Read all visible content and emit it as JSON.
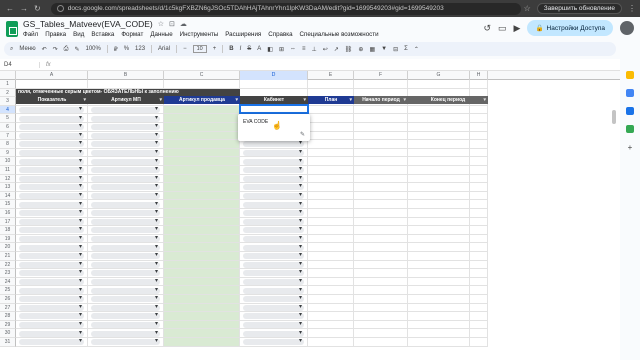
{
  "browser": {
    "url": "docs.google.com/spreadsheets/d/1c5kgFXBZN6gJSOc5TDAhHAjTAhnrYhn1lpKW3DaAM/edit?gid=1699549203#gid=1699549203",
    "update_button": "Завершить обновление"
  },
  "doc": {
    "title": "GS_Tables_Matveev(EVA_CODE)",
    "menu": [
      "Файл",
      "Правка",
      "Вид",
      "Вставка",
      "Формат",
      "Данные",
      "Инструменты",
      "Расширения",
      "Справка",
      "Специальные возможности"
    ],
    "access_button": "Настройки Доступа"
  },
  "toolbar": {
    "menu_label": "Меню",
    "zoom": "100%",
    "font": "Arial",
    "font_size": "10",
    "number_format": "123"
  },
  "formula": {
    "cell_ref": "D4",
    "fx": "fx"
  },
  "columns": [
    "A",
    "B",
    "C",
    "D",
    "E",
    "F",
    "G",
    "H"
  ],
  "rows": [
    "1",
    "2",
    "3",
    "4",
    "5",
    "6",
    "7",
    "8",
    "9",
    "10",
    "11",
    "12",
    "13",
    "14",
    "15",
    "16",
    "17",
    "18",
    "19",
    "20",
    "21",
    "22",
    "23",
    "24",
    "25",
    "26",
    "27",
    "28",
    "29",
    "30",
    "31"
  ],
  "sheet": {
    "banner": "поля, отмеченные серым цветом- ОБЯЗАТЕЛЬНЫ к заполнению",
    "headers": [
      "Показатель",
      "Артикул МП",
      "Артикул продавца",
      "Кабинет",
      "План",
      "Начало период",
      "Конец период"
    ]
  },
  "popup": {
    "option": "EVA CODE"
  },
  "colors": {
    "green_column": "#d9ead3",
    "header_dark": "#434343",
    "header_blue": "#1f3a93",
    "accent": "#1a73e8"
  }
}
